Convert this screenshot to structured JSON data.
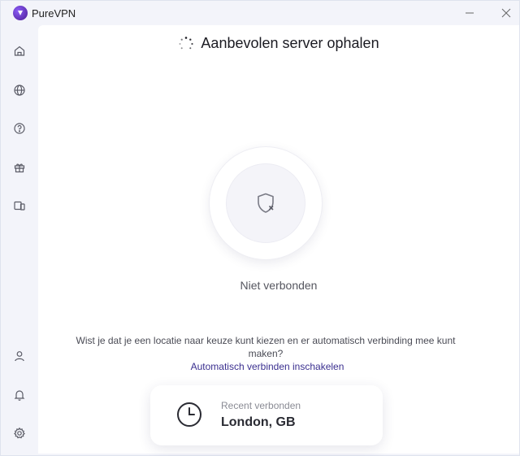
{
  "window": {
    "title": "PureVPN",
    "brand_color": "#5b21b6"
  },
  "sidebar": {
    "items": [
      {
        "icon": "home-icon",
        "name": "sidebar-item-home"
      },
      {
        "icon": "globe-icon",
        "name": "sidebar-item-locations"
      },
      {
        "icon": "help-icon",
        "name": "sidebar-item-help"
      },
      {
        "icon": "gift-icon",
        "name": "sidebar-item-offers"
      },
      {
        "icon": "devices-icon",
        "name": "sidebar-item-devices"
      },
      {
        "icon": "user-icon",
        "name": "sidebar-item-account"
      },
      {
        "icon": "bell-icon",
        "name": "sidebar-item-notifications"
      },
      {
        "icon": "gear-icon",
        "name": "sidebar-item-settings"
      }
    ]
  },
  "main": {
    "status_title": "Aanbevolen server ophalen",
    "connection_status": "Niet verbonden",
    "tip_text": "Wist je dat je een locatie naar keuze kunt kiezen en er automatisch verbinding mee kunt maken?",
    "tip_link": "Automatisch verbinden inschakelen",
    "recent": {
      "label": "Recent verbonden",
      "server": "London, GB"
    }
  }
}
